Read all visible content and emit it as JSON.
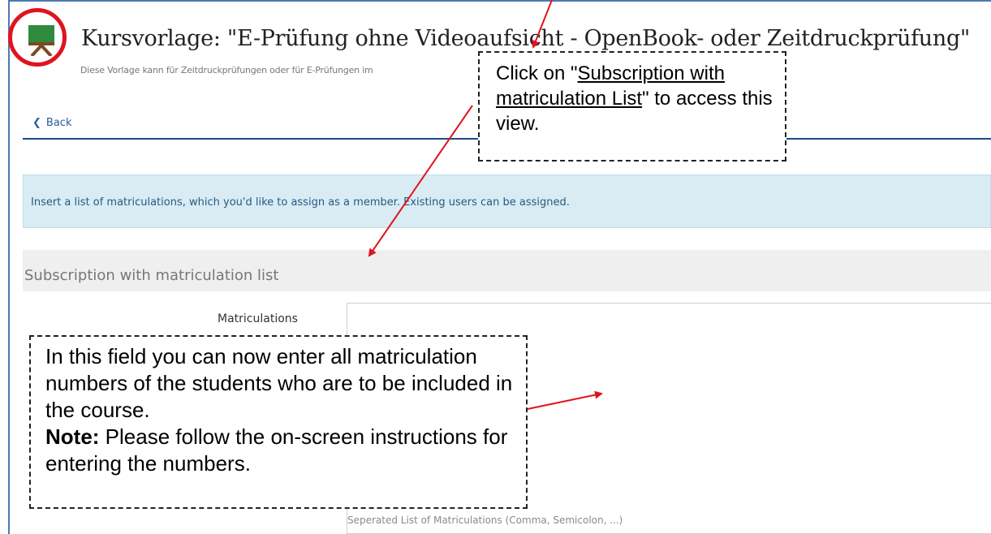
{
  "course": {
    "title": "Kursvorlage: \"E-Prüfung ohne Videoaufsicht - OpenBook- oder Zeitdruckprüfung\"",
    "description": "Diese Vorlage kann für Zeitdruckprüfungen oder für E-Prüfungen im",
    "icon": "course-board-icon"
  },
  "nav": {
    "back_label": "Back"
  },
  "info": {
    "message": "Insert a list of matriculations, which you'd like to assign as a member. Existing users can be assigned."
  },
  "form": {
    "section_title": "Subscription with matriculation list",
    "matriculations_label": "Matriculations",
    "matriculations_value": "",
    "help_text": "Seperated List of Matriculations (Comma, Semicolon, ...)"
  },
  "annotations": {
    "top": {
      "prefix": "Click on \"",
      "link": "Subscription with matriculation List",
      "suffix": "\" to access this view."
    },
    "bottom": {
      "text": "In this field you can now enter all matriculation numbers of the students who are to be included in the course.",
      "note_label": "Note:",
      "note_text": " Please follow the on-screen instructions for entering the numbers."
    }
  },
  "colors": {
    "accent": "#4d79b3",
    "annotation": "#e0141e",
    "info_bg": "#d9ecf3"
  }
}
